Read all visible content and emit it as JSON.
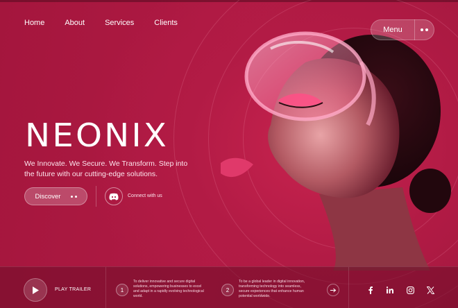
{
  "nav": {
    "items": [
      {
        "label": "Home"
      },
      {
        "label": "About"
      },
      {
        "label": "Services"
      },
      {
        "label": "Clients"
      }
    ],
    "menu_label": "Menu"
  },
  "hero": {
    "brand": "NEONIX",
    "tagline": "We Innovate. We Secure. We Transform. Step into the future with our cutting-edge solutions.",
    "discover_label": "Discover",
    "connect_label": "Connect with us"
  },
  "bottom": {
    "play_label": "PLAY TRAILER",
    "points": [
      {
        "num": "1",
        "text": "To deliver innovative and secure digital solutions, empowering businesses to excel and adapt in a rapidly evolving technological world."
      },
      {
        "num": "2",
        "text": "To be a global leader in digital innovation, transforming technology into seamless, secure experiences that enhance human potential worldwide."
      }
    ],
    "social": [
      "facebook-icon",
      "linkedin-icon",
      "instagram-icon",
      "x-icon"
    ]
  },
  "colors": {
    "background": "#a3173e",
    "accent": "#ff4f86"
  }
}
